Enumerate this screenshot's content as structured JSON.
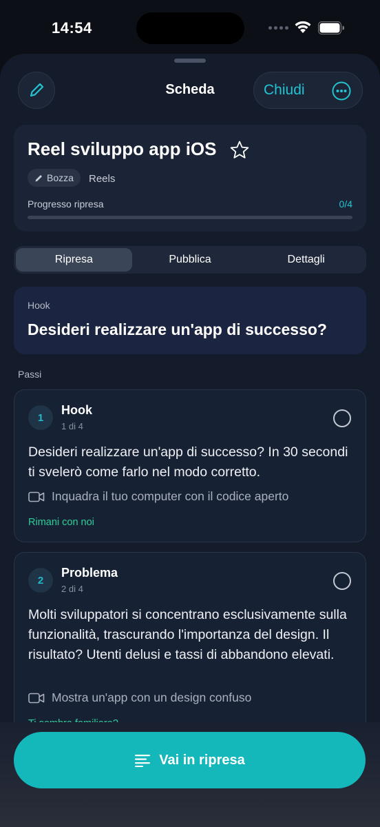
{
  "status_bar": {
    "time": "14:54"
  },
  "header": {
    "title": "Scheda",
    "close_label": "Chiudi"
  },
  "script": {
    "title": "Reel sviluppo app iOS",
    "status_badge": "Bozza",
    "type": "Reels",
    "progress_label": "Progresso ripresa",
    "progress_count": "0/4",
    "progress_fraction": 0
  },
  "tabs": [
    {
      "label": "Ripresa",
      "active": true
    },
    {
      "label": "Pubblica",
      "active": false
    },
    {
      "label": "Dettagli",
      "active": false
    }
  ],
  "hook": {
    "label": "Hook",
    "text": "Desideri realizzare un'app di successo?"
  },
  "steps_section": {
    "label": "Passi"
  },
  "steps": [
    {
      "number": "1",
      "title": "Hook",
      "count": "1 di 4",
      "body": "Desideri realizzare un'app di successo? In 30 secondi ti svelerò come farlo nel modo corretto.",
      "shot": "Inquadra il tuo computer con il codice aperto",
      "hint": "Rimani con noi"
    },
    {
      "number": "2",
      "title": "Problema",
      "count": "2 di 4",
      "body": "Molti sviluppatori si concentrano esclusivamente sulla funzionalità, trascurando l'importanza del design. Il risultato? Utenti delusi e tassi di abbandono elevati.",
      "shot": "Mostra un'app con un design confuso",
      "hint": "Ti sembra familiare?"
    }
  ],
  "primary_action": {
    "label": "Vai in ripresa"
  },
  "colors": {
    "accent": "#22c3d3",
    "button": "#14b8bb",
    "hint": "#2ecf9a"
  }
}
